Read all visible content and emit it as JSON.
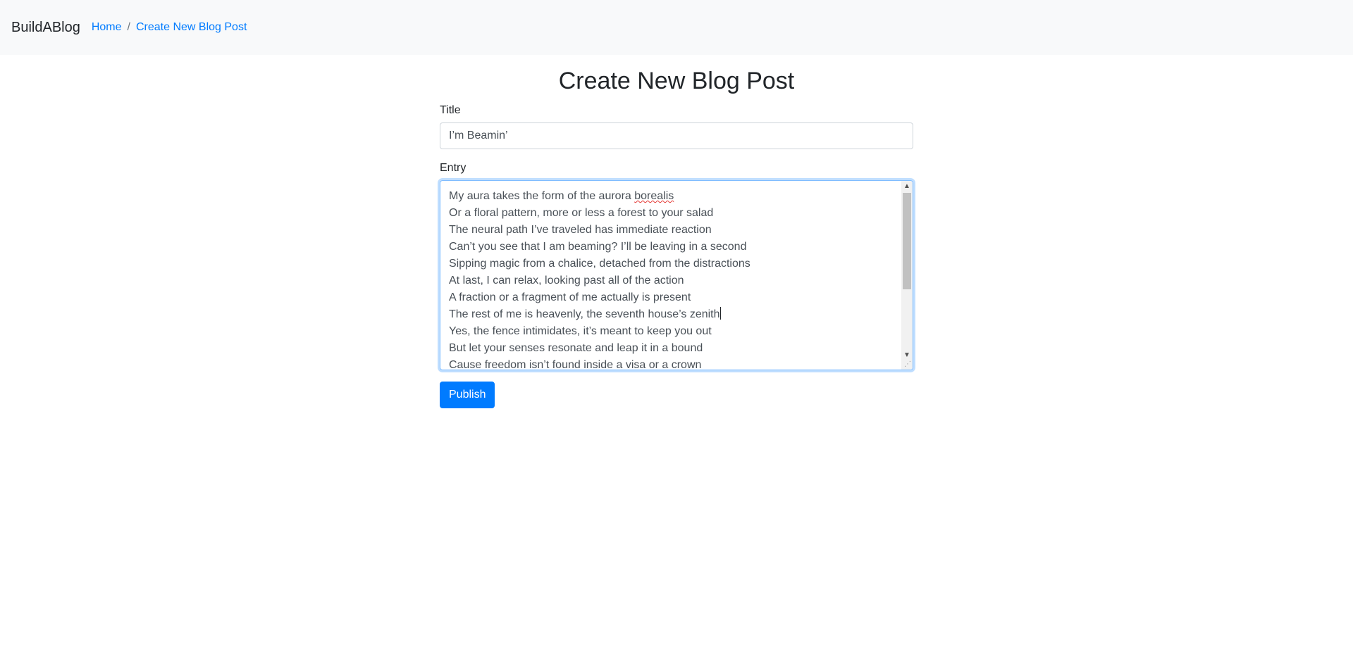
{
  "navbar": {
    "brand": "BuildABlog",
    "breadcrumb": [
      {
        "label": "Home"
      },
      {
        "label": "Create New Blog Post"
      }
    ],
    "separator": "/"
  },
  "page": {
    "heading": "Create New Blog Post"
  },
  "form": {
    "title_label": "Title",
    "title_value": "I’m Beamin’",
    "entry_label": "Entry",
    "entry_lines": [
      {
        "before": "My aura takes the form of the aurora ",
        "misspelled": "borealis",
        "after": ""
      },
      {
        "before": "Or a floral pattern, more or less a forest to your salad",
        "misspelled": "",
        "after": ""
      },
      {
        "before": "The neural path I’ve traveled has immediate reaction",
        "misspelled": "",
        "after": ""
      },
      {
        "before": "Can’t you see that I am beaming? I’ll be leaving in a second",
        "misspelled": "",
        "after": ""
      },
      {
        "before": "Sipping magic from a chalice, detached from the distractions",
        "misspelled": "",
        "after": ""
      },
      {
        "before": "At last, I can relax, looking past all of the action",
        "misspelled": "",
        "after": ""
      },
      {
        "before": "A fraction or a fragment of me actually is present",
        "misspelled": "",
        "after": ""
      },
      {
        "before": "The rest of me is heavenly, the seventh house’s zenith",
        "misspelled": "",
        "after": ""
      },
      {
        "before": "Yes, the fence intimidates, it’s meant to keep you out",
        "misspelled": "",
        "after": ""
      },
      {
        "before": "But let your senses resonate and leap it in a bound",
        "misspelled": "",
        "after": ""
      },
      {
        "before": "Cause freedom isn’t found inside a visa or a crown",
        "misspelled": "",
        "after": ""
      }
    ],
    "caret_line": 7,
    "publish_label": "Publish"
  },
  "icons": {
    "scroll_up": "scroll-up-arrow-icon",
    "scroll_down": "scroll-down-arrow-icon",
    "resize": "resize-grip-icon"
  },
  "colors": {
    "accent": "#007bff",
    "navbar_bg": "#f8f9fa",
    "focus_border": "#80bdff",
    "spellcheck": "#e53935"
  }
}
